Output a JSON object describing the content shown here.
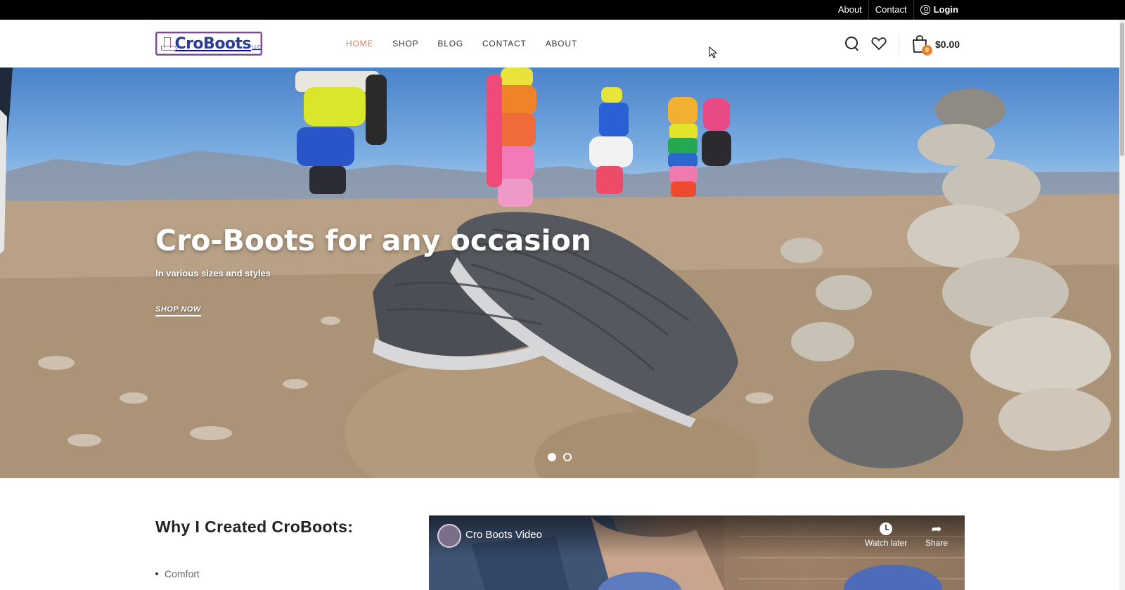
{
  "topbar": {
    "about": "About",
    "contact": "Contact",
    "login": "Login"
  },
  "header": {
    "logo_text": "CroBoots",
    "logo_suffix": "LLC",
    "nav": [
      {
        "label": "HOME",
        "active": true
      },
      {
        "label": "SHOP",
        "active": false
      },
      {
        "label": "BLOG",
        "active": false
      },
      {
        "label": "CONTACT",
        "active": false
      },
      {
        "label": "ABOUT",
        "active": false
      }
    ],
    "cart_count": "0",
    "cart_total": "$0.00",
    "accent_color": "#d4845a",
    "badge_color": "#e8842c"
  },
  "hero": {
    "title": "Cro-Boots for any occasion",
    "subtitle": "In various sizes and styles",
    "cta": "SHOP NOW",
    "slides": 2,
    "active_slide": 1
  },
  "why": {
    "title": "Why I Created CroBoots:",
    "items": [
      "Comfort"
    ]
  },
  "video": {
    "title": "Cro Boots Video",
    "watch_later": "Watch later",
    "share": "Share"
  },
  "icons": [
    "user-icon",
    "search-icon",
    "heart-icon",
    "cart-icon",
    "clock-icon",
    "share-icon"
  ]
}
